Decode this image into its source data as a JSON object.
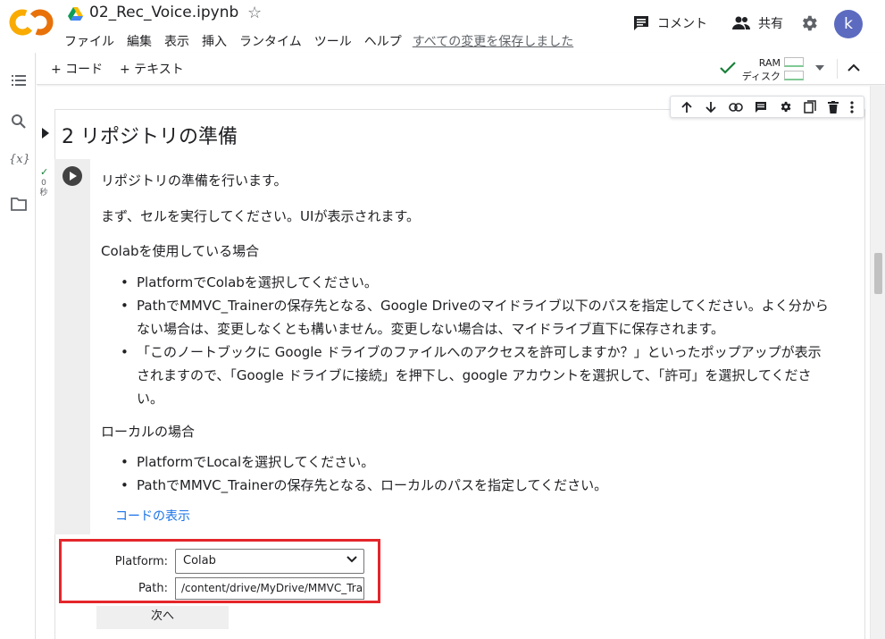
{
  "header": {
    "notebook_title": "02_Rec_Voice.ipynb",
    "menu": [
      "ファイル",
      "編集",
      "表示",
      "挿入",
      "ランタイム",
      "ツール",
      "ヘルプ"
    ],
    "save_status": "すべての変更を保存しました",
    "comment_label": "コメント",
    "share_label": "共有",
    "avatar_letter": "k"
  },
  "toolbar": {
    "add_code_label": "+ コード",
    "add_text_label": "+ テキスト",
    "ram_label": "RAM",
    "disk_label": "ディスク"
  },
  "cell": {
    "heading": "2 リポジトリの準備",
    "exec_time": "0\n秒",
    "intro": "リポジトリの準備を行います。",
    "instruction": "まず、セルを実行してください。UIが表示されます。",
    "colab_heading": "Colabを使用している場合",
    "colab_items": [
      "PlatformでColabを選択してください。",
      "PathでMMVC_Trainerの保存先となる、Google Driveのマイドライブ以下のパスを指定してください。よく分から",
      "ない場合は、変更しなくとも構いません。変更しない場合は、マイドライブ直下に保存されます。",
      "「このノートブックに Google ドライブのファイルへのアクセスを許可しますか？」といったポップアップが表示",
      "されますので、「Google ドライブに接続」を押下し、google アカウントを選択して、「許可」を選択してくださ",
      "い。"
    ],
    "local_heading": "ローカルの場合",
    "local_items": [
      "PlatformでLocalを選択してください。",
      "PathでMMVC_Trainerの保存先となる、ローカルのパスを指定してください。"
    ],
    "show_code_label": "コードの表示"
  },
  "form": {
    "platform_label": "Platform:",
    "platform_value": "Colab",
    "path_label": "Path:",
    "path_value": "/content/drive/MyDrive/MMVC_Tra",
    "next_label": "次へ"
  },
  "colors": {
    "logo_orange": "#f9ab00",
    "logo_dark_orange": "#e8710a",
    "link_blue": "#1a73e8",
    "highlight_red": "#e4262b",
    "avatar_bg": "#5c6bc0",
    "status_green": "#188038"
  },
  "icons": [
    "colab-logo-icon",
    "drive-icon",
    "star-icon",
    "comment-icon",
    "people-icon",
    "gear-icon",
    "toc-icon",
    "search-icon",
    "variables-icon",
    "folder-icon",
    "check-icon",
    "caret-down-icon",
    "chevron-up-icon",
    "arrow-up-icon",
    "arrow-down-icon",
    "link-icon",
    "comment-cell-icon",
    "cell-gear-icon",
    "mirror-cell-icon",
    "trash-icon",
    "more-vert-icon",
    "play-icon"
  ]
}
